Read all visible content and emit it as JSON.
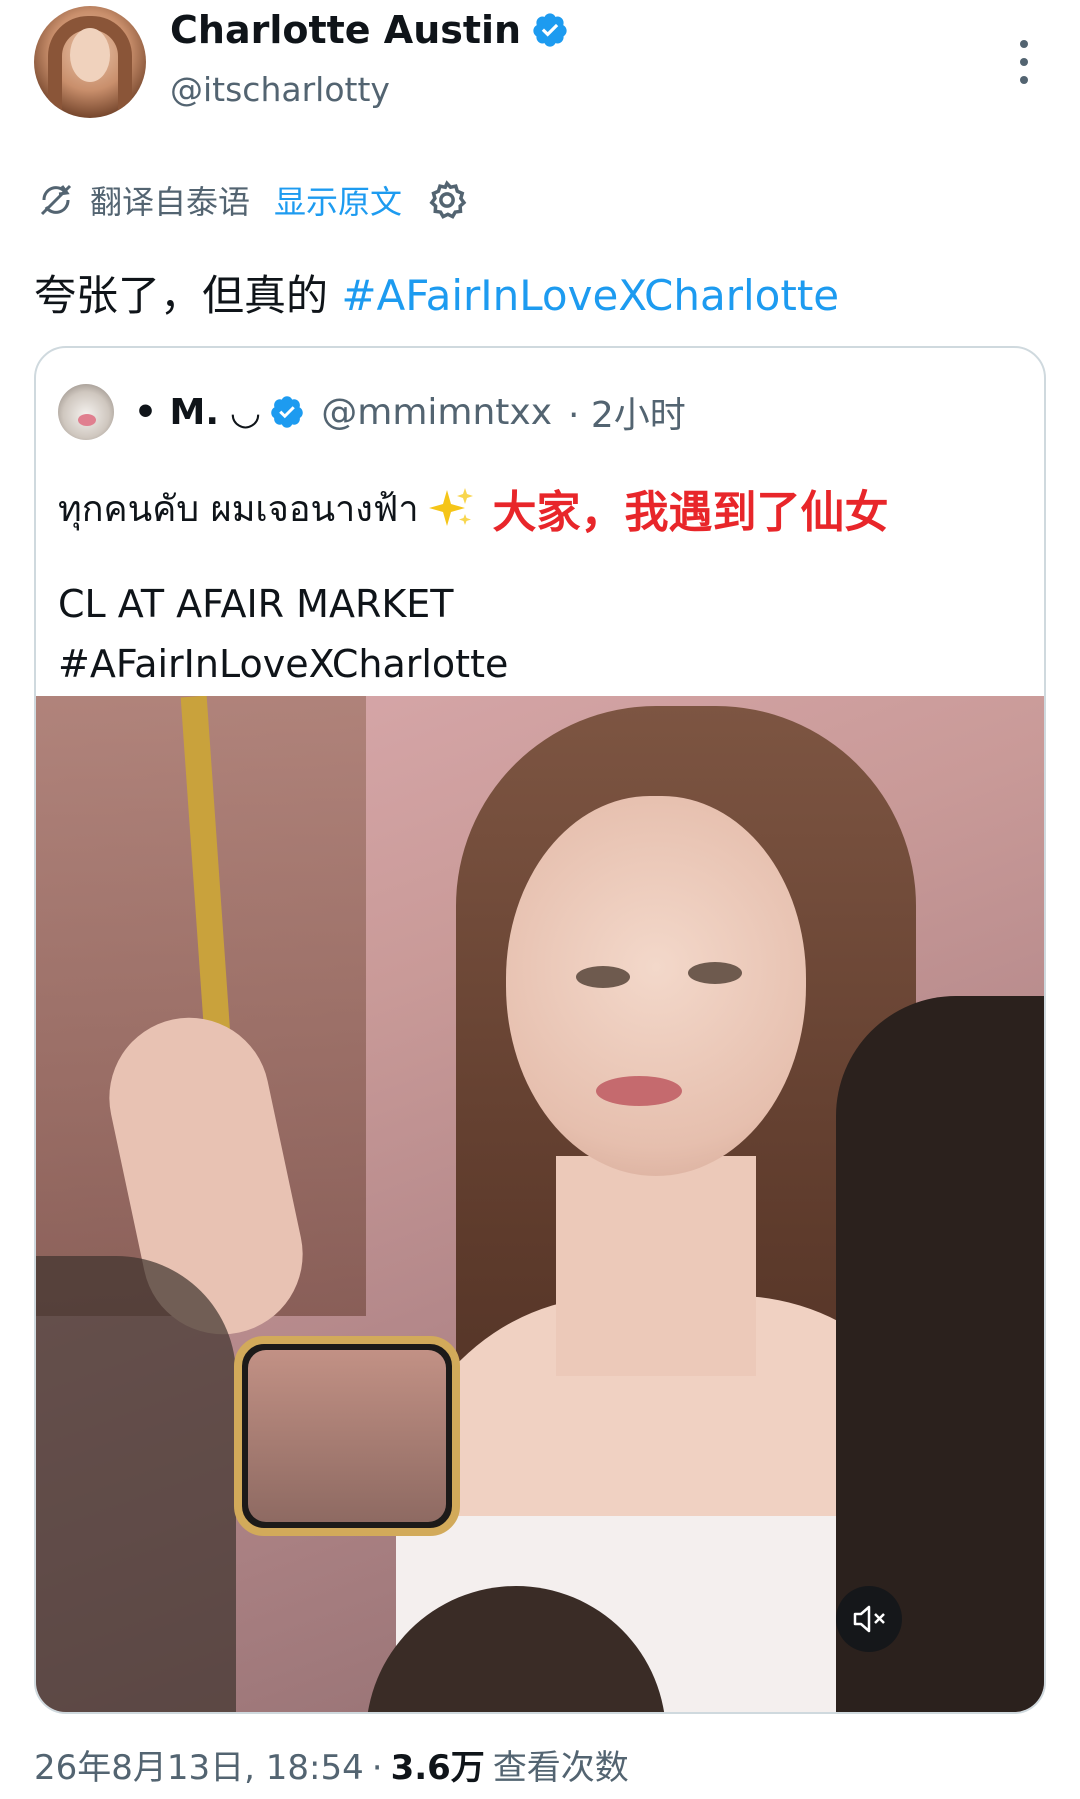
{
  "author": {
    "display_name": "Charlotte Austin",
    "handle": "@itscharlotty",
    "verified": true
  },
  "translation": {
    "from_label": "翻译自泰语",
    "show_original_label": "显示原文"
  },
  "tweet": {
    "text": "夸张了，但真的 ",
    "hashtag": "#AFairInLoveXCharlotte"
  },
  "quoted": {
    "name": "• M. ◡",
    "handle": "@mmimntxx",
    "meta": "· 2小时",
    "thai_text": "ทุกคนคับ ผมเจอนางฟ้า",
    "red_caption": "大家，我遇到了仙女",
    "body_line1": "CL AT AFAIR MARKET",
    "body_line2": "#AFairInLoveXCharlotte"
  },
  "footer": {
    "timestamp": "26年8月13日, 18:54",
    "separator": "·",
    "views_count": "3.6万",
    "views_label": "查看次数"
  },
  "colors": {
    "accent": "#1d9bf0",
    "secondary_text": "#536471",
    "primary_text": "#0f1419",
    "caption_red": "#e8262a",
    "border": "#cfd9de"
  },
  "icons": [
    "verified-badge-icon",
    "more-options-icon",
    "translate-icon",
    "settings-gear-icon",
    "sparkle-emoji-icon",
    "mute-speaker-icon"
  ]
}
